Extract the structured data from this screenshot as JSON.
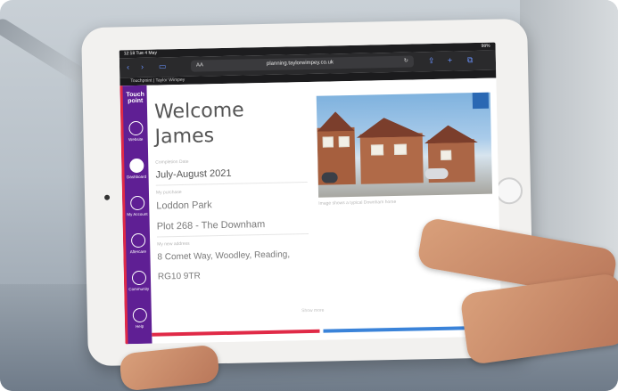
{
  "status": {
    "time": "12:18  Tue 4 May",
    "battery": "98%"
  },
  "browser": {
    "aa": "AA",
    "url": "planning.taylorwimpey.co.uk",
    "reload": "↻",
    "tab_title": "Touchpoint | Taylor Wimpey"
  },
  "sidebar": {
    "logo_line1": "Touch",
    "logo_line2": "point",
    "items": [
      {
        "label": "Website"
      },
      {
        "label": "Dashboard"
      },
      {
        "label": "My Account"
      },
      {
        "label": "Aftercare"
      },
      {
        "label": "Community"
      },
      {
        "label": "Help"
      }
    ]
  },
  "main": {
    "welcome_line1": "Welcome",
    "welcome_line2": "James",
    "completion_label": "Completion Date",
    "completion_value": "July-August 2021",
    "purchase_label": "My purchase",
    "development": "Loddon Park",
    "plot": "Plot 268 - The Downham",
    "address_label": "My new address",
    "address_line1": "8 Comet Way, Woodley, Reading,",
    "address_line2": "RG10 9TR",
    "image_caption": "Image shows a typical Downham home",
    "show_more": "Show more"
  },
  "colors": {
    "sidebar": "#5f1f94",
    "accent_red": "#e02a47",
    "accent_blue": "#3a83d9"
  }
}
